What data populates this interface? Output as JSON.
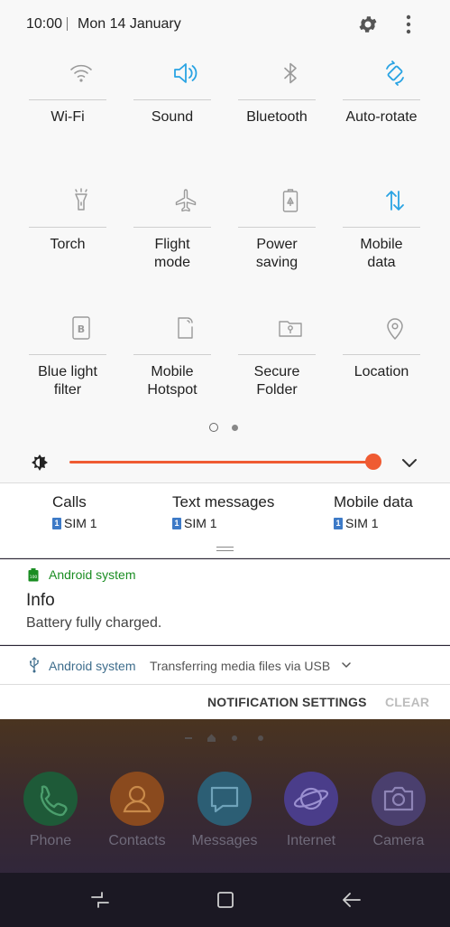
{
  "status": {
    "time": "10:00",
    "date": "Mon 14 January"
  },
  "tiles": [
    {
      "label": "Wi-Fi",
      "icon": "wifi-icon",
      "active": false
    },
    {
      "label": "Sound",
      "icon": "sound-icon",
      "active": true
    },
    {
      "label": "Bluetooth",
      "icon": "bluetooth-icon",
      "active": false
    },
    {
      "label": "Auto-rotate",
      "icon": "auto-rotate-icon",
      "active": true
    },
    {
      "label": "Torch",
      "icon": "torch-icon",
      "active": false
    },
    {
      "label": "Flight\nmode",
      "icon": "airplane-icon",
      "active": false
    },
    {
      "label": "Power\nsaving",
      "icon": "power-saving-icon",
      "active": false
    },
    {
      "label": "Mobile\ndata",
      "icon": "mobile-data-icon",
      "active": true
    },
    {
      "label": "Blue light\nfilter",
      "icon": "blue-light-filter-icon",
      "active": false
    },
    {
      "label": "Mobile\nHotspot",
      "icon": "hotspot-icon",
      "active": false
    },
    {
      "label": "Secure\nFolder",
      "icon": "secure-folder-icon",
      "active": false
    },
    {
      "label": "Location",
      "icon": "location-icon",
      "active": false
    }
  ],
  "brightness": {
    "level_percent": 100,
    "accent": "#ef5b32"
  },
  "sim": [
    {
      "title": "Calls",
      "sim": "SIM 1"
    },
    {
      "title": "Text messages",
      "sim": "SIM 1"
    },
    {
      "title": "Mobile data",
      "sim": "SIM 1"
    }
  ],
  "notification": {
    "app": "Android system",
    "title": "Info",
    "body": "Battery fully charged."
  },
  "usb": {
    "app": "Android system",
    "message": "Transferring media files via USB"
  },
  "actions": {
    "settings": "NOTIFICATION SETTINGS",
    "clear": "CLEAR"
  },
  "dock": [
    {
      "label": "Phone",
      "color": "#1e5a38"
    },
    {
      "label": "Contacts",
      "color": "#8a4a1e"
    },
    {
      "label": "Messages",
      "color": "#2c5e74"
    },
    {
      "label": "Internet",
      "color": "#4a3d8a"
    },
    {
      "label": "Camera",
      "color": "#4a3f6e"
    }
  ],
  "colors": {
    "active_icon": "#29a3e3",
    "inactive_icon": "#9a9a9a",
    "app_green": "#1a8d22"
  }
}
